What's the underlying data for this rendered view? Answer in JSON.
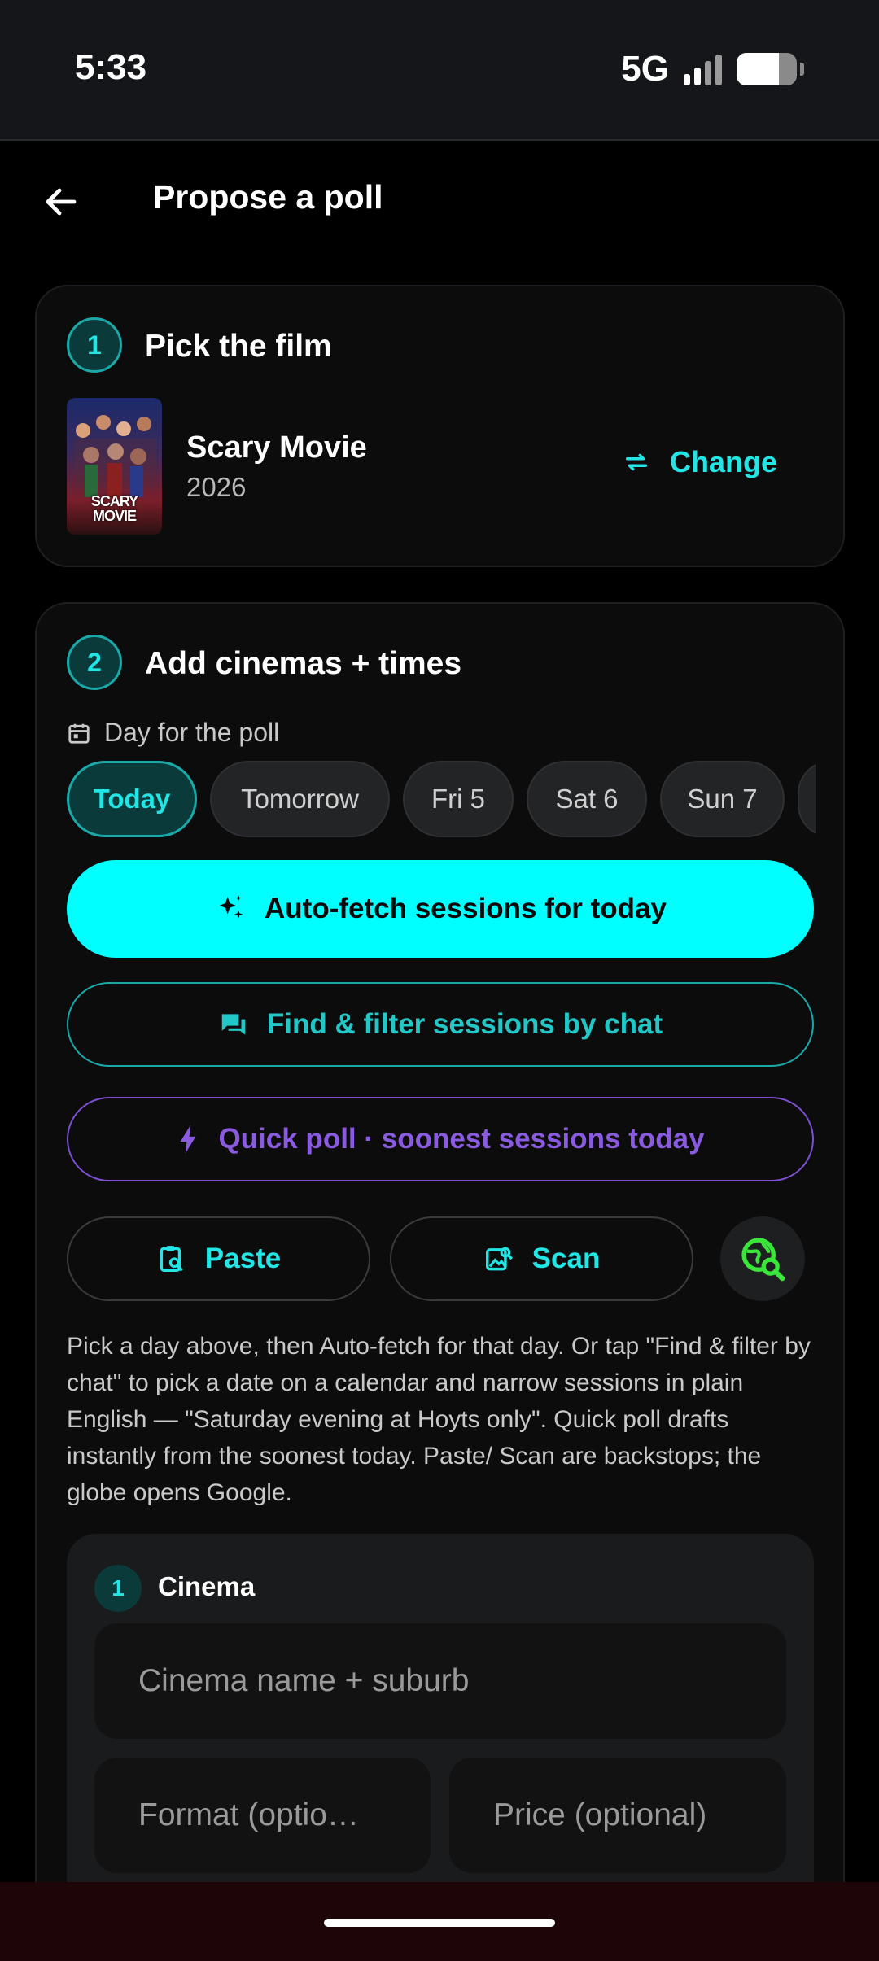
{
  "status": {
    "time": "5:33",
    "network": "5G"
  },
  "header": {
    "title": "Propose a poll"
  },
  "film_section": {
    "step": "1",
    "title": "Pick the film",
    "film_title": "Scary Movie",
    "film_year": "2026",
    "poster_text": "SCARY MOVIE",
    "change_label": "Change"
  },
  "sessions_section": {
    "step": "2",
    "title": "Add cinemas + times",
    "day_label": "Day for the poll",
    "days": [
      "Today",
      "Tomorrow",
      "Fri 5",
      "Sat 6",
      "Sun 7"
    ],
    "selected_day": "Today",
    "autofetch_label": "Auto-fetch sessions for today",
    "find_label": "Find & filter sessions by chat",
    "quick_label": "Quick poll · soonest sessions today",
    "paste_label": "Paste",
    "scan_label": "Scan",
    "help_text": "Pick a day above, then Auto-fetch for that day. Or tap \"Find & filter by chat\" to pick a date on a calendar and narrow sessions in plain English — \"Saturday evening at Hoyts only\". Quick poll drafts instantly from the soonest today. Paste/ Scan are backstops; the globe opens Google."
  },
  "cinema": {
    "step": "1",
    "label": "Cinema",
    "name_placeholder": "Cinema name + suburb",
    "format_placeholder": "Format (optio…",
    "price_placeholder": "Price (optional)"
  },
  "colors": {
    "accent": "#00ffff",
    "accent_text": "#22e6e6",
    "quick": "#8a5ae0",
    "globe": "#39e639"
  }
}
